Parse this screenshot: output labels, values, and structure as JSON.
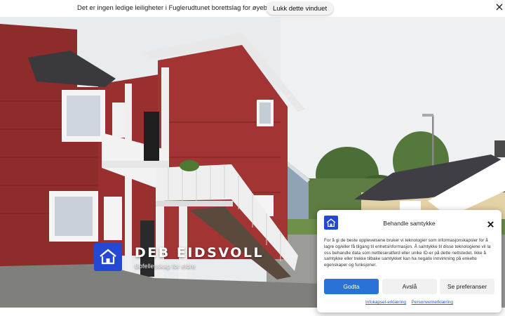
{
  "notice": {
    "text": "Det er ingen ledige leiligheter i Fuglerudtunet borettslag for øyeblikket.",
    "close_label": "Lukk dette vinduet",
    "close_icon": "close-icon"
  },
  "brand": {
    "title": "DEB EIDSVOLL",
    "subtitle": "Bofellesskap for eldre",
    "logo_icon": "house-icon",
    "logo_color": "#2348d4"
  },
  "consent": {
    "title": "Behandle samtykke",
    "body": "For å gi de beste opplevelsene bruker vi teknologier som informasjonskapsler for å lagre og/eller få tilgang til enhetsinformasjon. Å samtykke til disse teknologiene vil la oss behandle data som nettleseratferd eller unike ID-er på dette nettstedet. Ikke å samtykke eller trekke tilbake samtykket kan ha negativ innvirkning på enkelte egenskaper og funksjoner.",
    "buttons": {
      "accept": "Godta",
      "deny": "Avslå",
      "prefs": "Se preferanser"
    },
    "links": {
      "cookie": "Infokapsel-erklæring",
      "privacy": "Personvernerklæring"
    },
    "accent_color": "#2a72d6"
  }
}
